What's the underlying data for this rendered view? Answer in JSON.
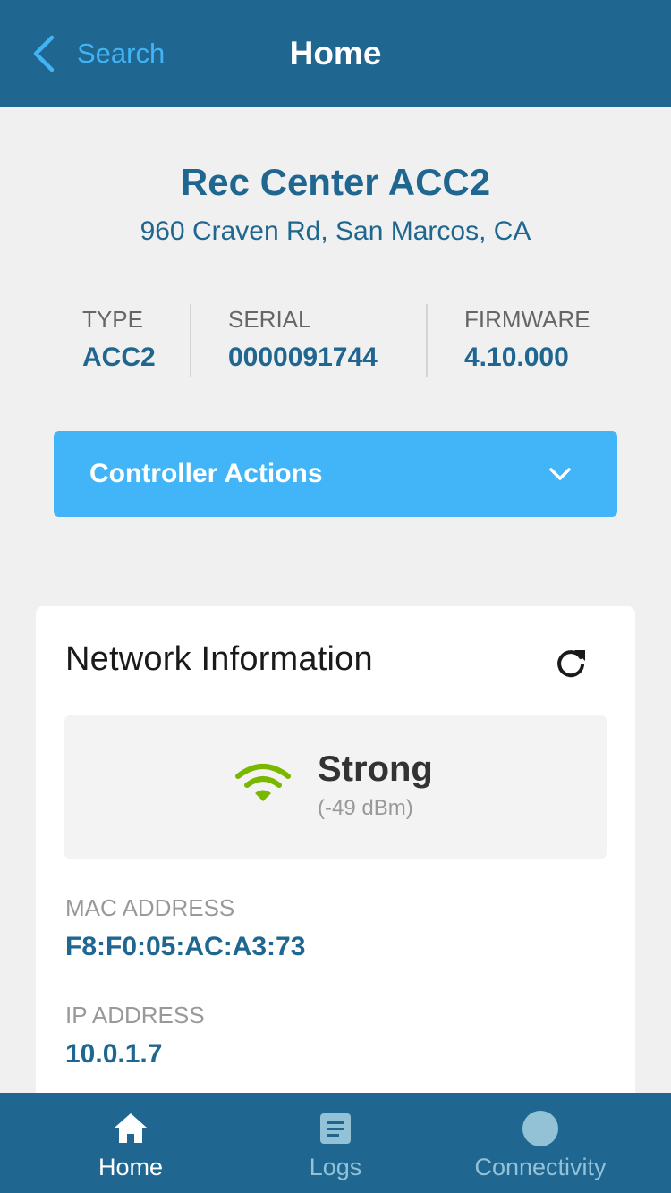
{
  "navbar": {
    "back_label": "Search",
    "title": "Home"
  },
  "site": {
    "name": "Rec Center ACC2",
    "address": "960 Craven Rd, San Marcos, CA"
  },
  "device_info": {
    "type_label": "TYPE",
    "type_value": "ACC2",
    "serial_label": "SERIAL",
    "serial_value": "0000091744",
    "firmware_label": "FIRMWARE",
    "firmware_value": "4.10.000"
  },
  "controller_actions": {
    "label": "Controller Actions"
  },
  "network": {
    "title": "Network Information",
    "signal_strength": "Strong",
    "signal_dbm": "(-49 dBm)",
    "mac_label": "MAC ADDRESS",
    "mac_value": "F8:F0:05:AC:A3:73",
    "ip_label": "IP ADDRESS",
    "ip_value": "10.0.1.7"
  },
  "tabs": [
    {
      "label": "Home",
      "icon": "home-icon",
      "active": true
    },
    {
      "label": "Logs",
      "icon": "logs-icon",
      "active": false
    },
    {
      "label": "Connectivity",
      "icon": "connectivity-icon",
      "active": false
    }
  ],
  "colors": {
    "primary": "#1f6690",
    "accent": "#42b4f8",
    "signal_good": "#7ab800"
  }
}
